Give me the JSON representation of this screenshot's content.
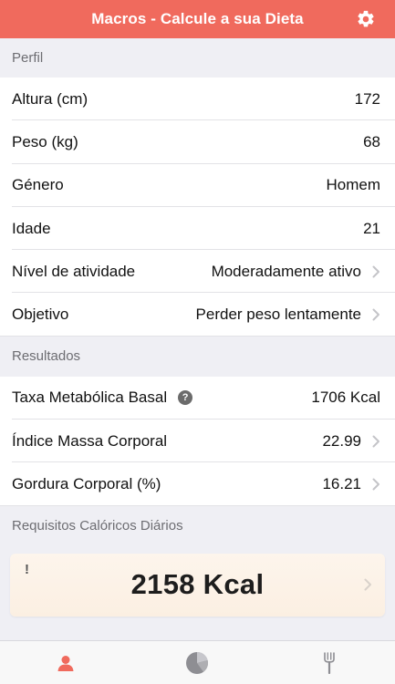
{
  "app": {
    "title": "Macros - Calcule a sua Dieta",
    "accent": "#f06a5d"
  },
  "profile": {
    "header": "Perfil",
    "rows": [
      {
        "label": "Altura (cm)",
        "value": "172"
      },
      {
        "label": "Peso (kg)",
        "value": "68"
      },
      {
        "label": "Género",
        "value": "Homem"
      },
      {
        "label": "Idade",
        "value": "21"
      },
      {
        "label": "Nível de atividade",
        "value": "Moderadamente ativo"
      },
      {
        "label": "Objetivo",
        "value": "Perder peso lentamente"
      }
    ]
  },
  "results": {
    "header": "Resultados",
    "rows": [
      {
        "label": "Taxa Metabólica Basal",
        "value": "1706 Kcal"
      },
      {
        "label": "Índice Massa Corporal",
        "value": "22.99"
      },
      {
        "label": "Gordura Corporal (%)",
        "value": "16.21"
      }
    ]
  },
  "calories": {
    "header": "Requisitos Calóricos Diários",
    "alert": "!",
    "value": "2158 Kcal"
  },
  "tabs": {
    "items": [
      {
        "icon": "person-icon",
        "active": true
      },
      {
        "icon": "pie-chart-icon",
        "active": false
      },
      {
        "icon": "fork-icon",
        "active": false
      }
    ]
  }
}
